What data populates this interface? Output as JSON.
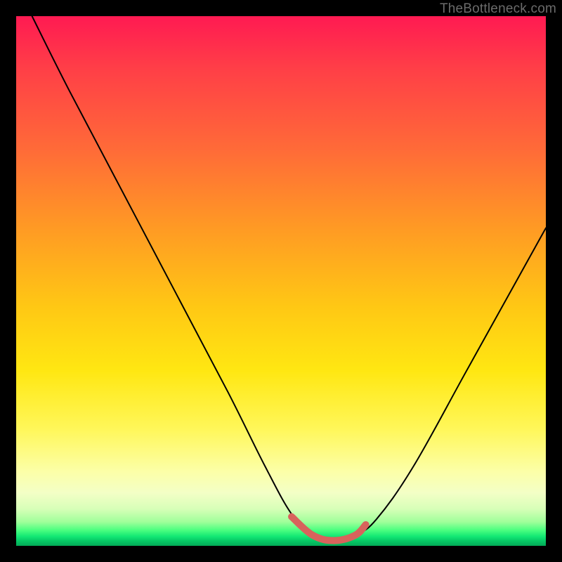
{
  "watermark": "TheBottleneck.com",
  "chart_data": {
    "type": "line",
    "title": "",
    "xlabel": "",
    "ylabel": "",
    "xlim": [
      0,
      100
    ],
    "ylim": [
      0,
      100
    ],
    "grid": false,
    "series": [
      {
        "name": "bottleneck-curve",
        "x": [
          3,
          10,
          20,
          30,
          40,
          47,
          52,
          56,
          60,
          64,
          68,
          75,
          85,
          95,
          100
        ],
        "values": [
          100,
          86,
          67,
          48,
          29,
          15,
          6,
          2,
          1,
          2,
          5,
          15,
          33,
          51,
          60
        ]
      }
    ],
    "annotations": [
      {
        "name": "optimal-range",
        "x": [
          52,
          56,
          60,
          64,
          66
        ],
        "values": [
          5.5,
          2,
          1,
          2,
          4
        ]
      }
    ]
  }
}
